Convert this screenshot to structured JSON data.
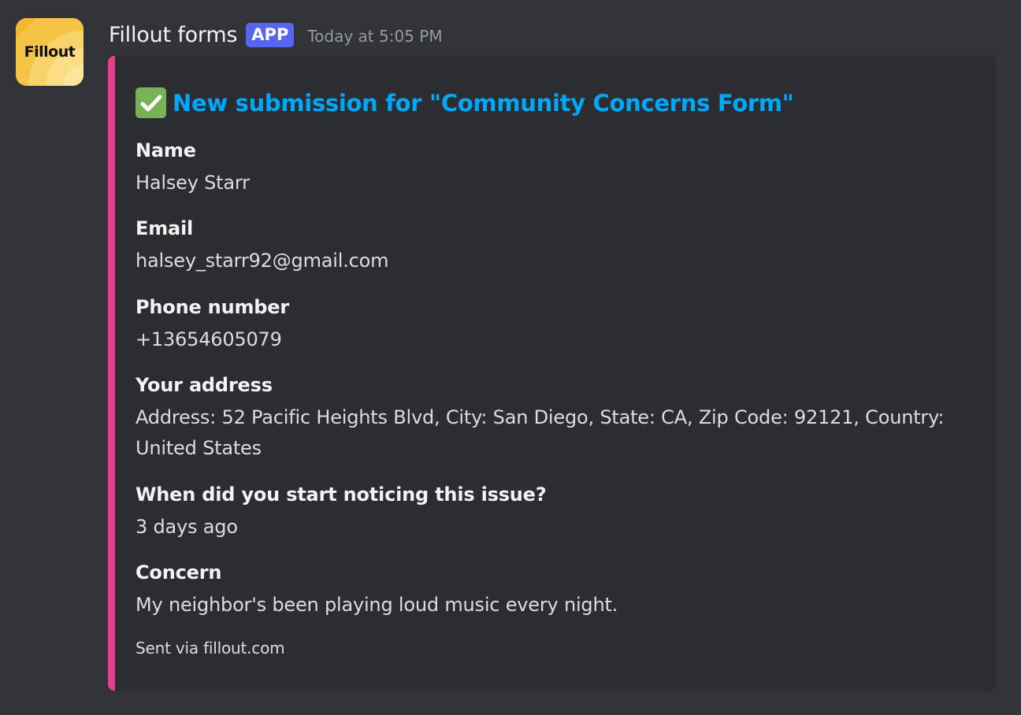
{
  "author": {
    "name": "Fillout forms",
    "badge": "APP",
    "timestamp": "Today at 5:05 PM",
    "avatar_text": "Fillout",
    "avatar_color": "#f6c94a"
  },
  "embed": {
    "accent_color": "#e63f8f",
    "title_icon": "check-mark-button-icon",
    "title": "New submission for \"Community Concerns Form\"",
    "fields": [
      {
        "name": "Name",
        "value": "Halsey Starr"
      },
      {
        "name": "Email",
        "value": "halsey_starr92@gmail.com"
      },
      {
        "name": "Phone number",
        "value": "+13654605079"
      },
      {
        "name": "Your address",
        "value": "Address: 52 Pacific Heights Blvd, City: San Diego, State: CA, Zip Code: 92121, Country: United States"
      },
      {
        "name": "When did you start noticing this issue?",
        "value": "3 days ago"
      },
      {
        "name": "Concern",
        "value": "My neighbor's been playing loud music every night."
      }
    ],
    "footer": "Sent via fillout.com"
  }
}
